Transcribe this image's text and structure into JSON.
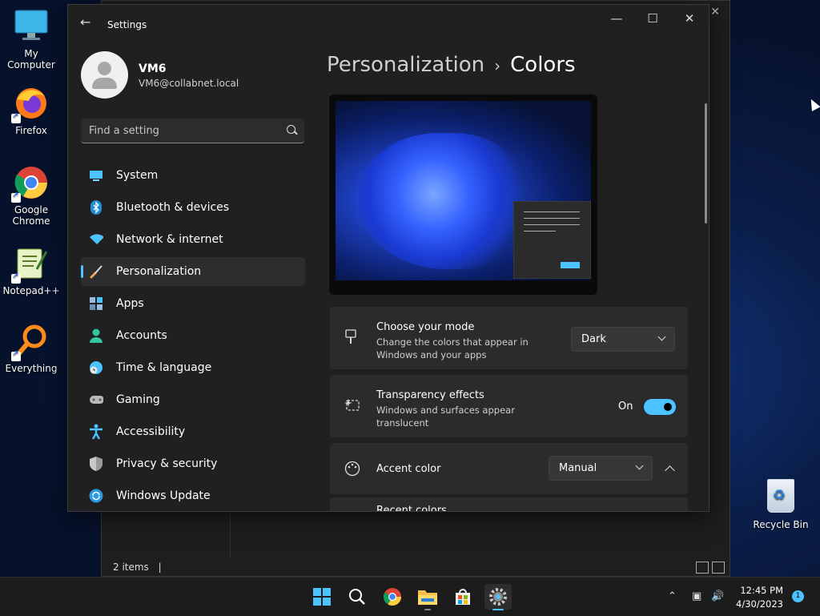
{
  "desktop": {
    "icons": [
      {
        "label": "My Computer"
      },
      {
        "label": "Firefox"
      },
      {
        "label": "Google Chrome"
      },
      {
        "label": "Notepad++"
      },
      {
        "label": "Everything"
      }
    ],
    "recycle_bin": "Recycle Bin"
  },
  "explorer": {
    "status": "2 items",
    "close_glyph": "✕"
  },
  "settings": {
    "title": "Settings",
    "back_glyph": "←",
    "window_controls": {
      "minimize": "—",
      "maximize": "☐",
      "close": "✕"
    },
    "profile": {
      "name": "VM6",
      "email": "VM6@collabnet.local"
    },
    "search": {
      "placeholder": "Find a setting"
    },
    "nav": [
      {
        "label": "System",
        "icon": "monitor-icon",
        "color": "#4cc2ff"
      },
      {
        "label": "Bluetooth & devices",
        "icon": "bluetooth-icon",
        "color": "#1f8dd6"
      },
      {
        "label": "Network & internet",
        "icon": "wifi-icon",
        "color": "#4cc2ff"
      },
      {
        "label": "Personalization",
        "icon": "brush-icon",
        "color": "#e8a46a"
      },
      {
        "label": "Apps",
        "icon": "apps-icon",
        "color": "#7aa6d9"
      },
      {
        "label": "Accounts",
        "icon": "person-icon",
        "color": "#35c6a0"
      },
      {
        "label": "Time & language",
        "icon": "globe-clock-icon",
        "color": "#4cc2ff"
      },
      {
        "label": "Gaming",
        "icon": "controller-icon",
        "color": "#b8b8b8"
      },
      {
        "label": "Accessibility",
        "icon": "accessibility-icon",
        "color": "#4cc2ff"
      },
      {
        "label": "Privacy & security",
        "icon": "shield-icon",
        "color": "#9a9a9a"
      },
      {
        "label": "Windows Update",
        "icon": "refresh-icon",
        "color": "#2a9be0"
      }
    ],
    "active_nav": "Personalization",
    "breadcrumb": {
      "parent": "Personalization",
      "separator": "›",
      "current": "Colors"
    },
    "cards": {
      "mode": {
        "title": "Choose your mode",
        "desc": "Change the colors that appear in Windows and your apps",
        "value": "Dark"
      },
      "transparency": {
        "title": "Transparency effects",
        "desc": "Windows and surfaces appear translucent",
        "state": "On"
      },
      "accent": {
        "title": "Accent color",
        "value": "Manual"
      },
      "recent": {
        "title": "Recent colors"
      }
    },
    "accent_color": "#4cc2ff"
  },
  "taskbar": {
    "clock_time": "12:45 PM",
    "clock_date": "4/30/2023",
    "notification_count": "1"
  }
}
